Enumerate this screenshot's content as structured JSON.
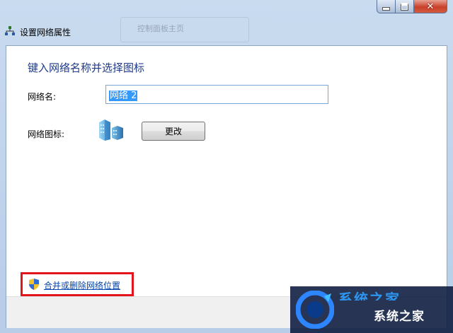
{
  "window": {
    "title": "设置网络属性",
    "background_hint": "控制面板主页"
  },
  "form": {
    "heading": "键入网络名称并选择图标",
    "name_label": "网络名:",
    "name_value": "网络  2",
    "icon_label": "网络图标:",
    "change_button": "更改"
  },
  "footer": {
    "merge_link": "合并或删除网络位置"
  },
  "watermark": {
    "brand": "系统之家",
    "partial_top": "系统之家"
  },
  "colors": {
    "heading": "#1e3a8a",
    "link": "#0645ad",
    "highlight_border": "#e3141b",
    "selection": "#3399ff"
  }
}
